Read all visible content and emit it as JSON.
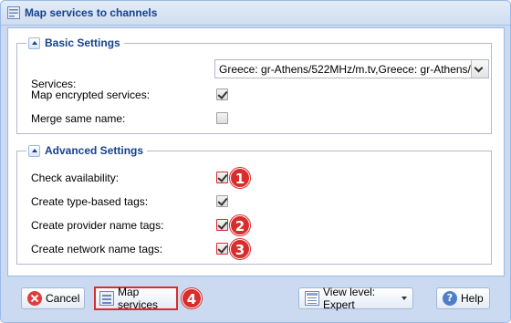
{
  "window": {
    "title": "Map services to channels"
  },
  "basic": {
    "legend": "Basic Settings",
    "services_label": "Services:",
    "services_value": "Greece: gr-Athens/522MHz/m.tv,Greece: gr-Athens/",
    "map_encrypted_label": "Map encrypted services:",
    "map_encrypted_checked": true,
    "merge_same_name_label": "Merge same name:",
    "merge_same_name_checked": false
  },
  "advanced": {
    "legend": "Advanced Settings",
    "check_availability_label": "Check availability:",
    "check_availability_checked": true,
    "type_tags_label": "Create type-based tags:",
    "type_tags_checked": true,
    "provider_tags_label": "Create provider name tags:",
    "provider_tags_checked": true,
    "network_tags_label": "Create network name tags:",
    "network_tags_checked": true
  },
  "badges": [
    "1",
    "2",
    "3",
    "4"
  ],
  "buttons": {
    "cancel": "Cancel",
    "map_services": "Map services",
    "view_level": "View level: Expert",
    "help": "Help"
  },
  "colors": {
    "accent": "#15428b",
    "highlight": "#d92c2c",
    "frame": "#cbdaf0"
  },
  "icons": {
    "title": "map-window-icon",
    "cancel": "cancel-icon",
    "map_services": "map-services-icon",
    "view_level": "view-level-icon",
    "help": "help-icon"
  }
}
